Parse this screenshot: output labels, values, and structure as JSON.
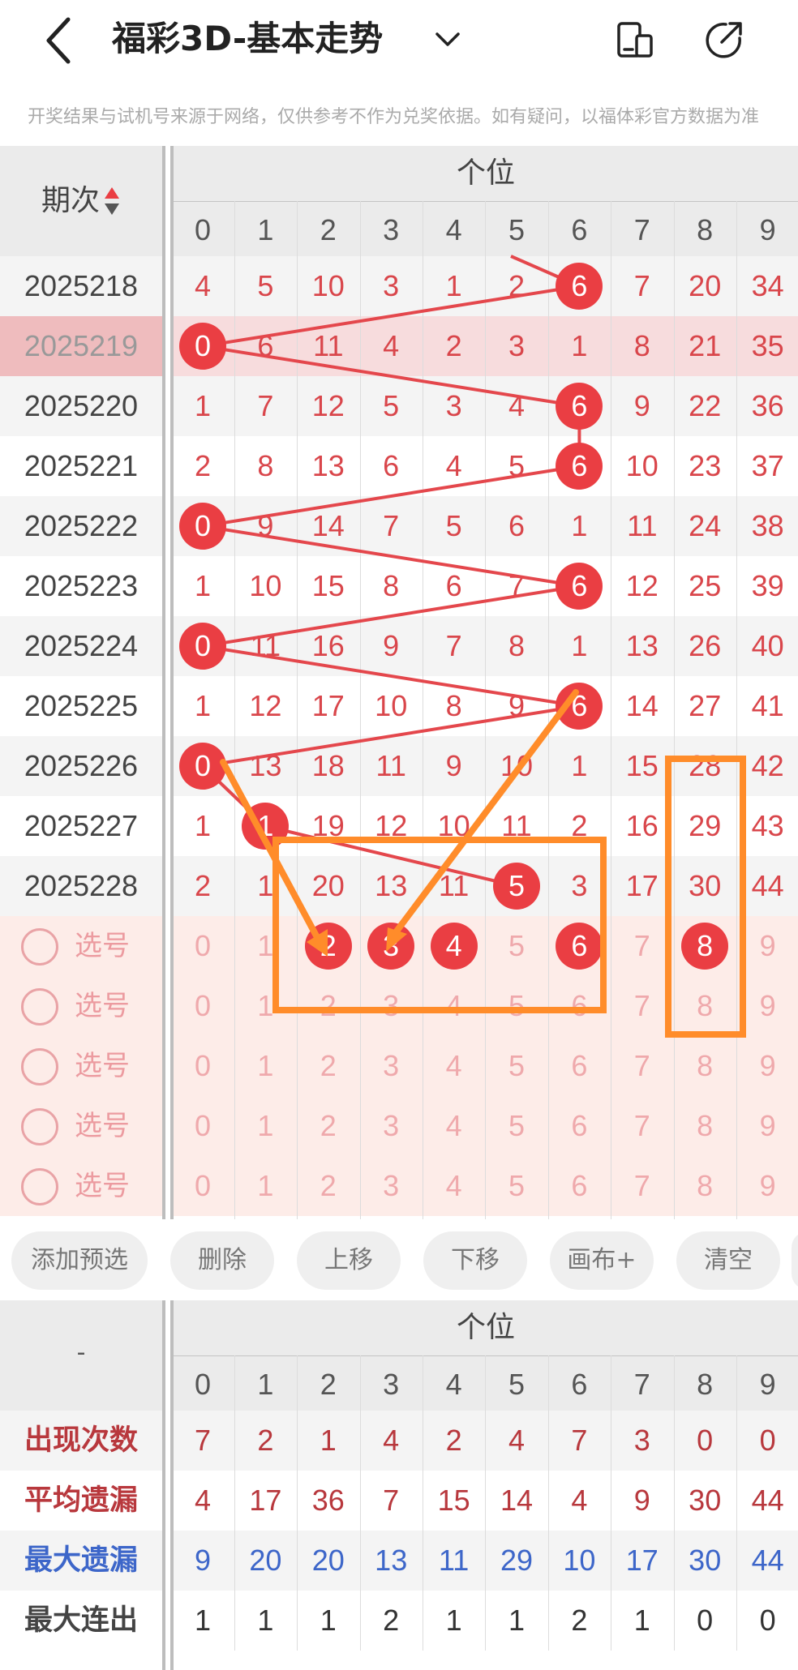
{
  "header": {
    "title": "福彩3D-基本走势",
    "notice": "开奖结果与试机号来源于网络，仅供参考不作为兑奖依据。如有疑问，以福体彩官方数据为准"
  },
  "table": {
    "period_header": "期次",
    "group_header": "个位",
    "digits": [
      "0",
      "1",
      "2",
      "3",
      "4",
      "5",
      "6",
      "7",
      "8",
      "9"
    ],
    "rows": [
      {
        "period": "2025218",
        "values": [
          "4",
          "5",
          "10",
          "3",
          "1",
          "2",
          "6",
          "7",
          "20",
          "34"
        ],
        "hit": 6
      },
      {
        "period": "2025219",
        "values": [
          "0",
          "6",
          "11",
          "4",
          "2",
          "3",
          "1",
          "8",
          "21",
          "35"
        ],
        "hit": 0
      },
      {
        "period": "2025220",
        "values": [
          "1",
          "7",
          "12",
          "5",
          "3",
          "4",
          "6",
          "9",
          "22",
          "36"
        ],
        "hit": 6
      },
      {
        "period": "2025221",
        "values": [
          "2",
          "8",
          "13",
          "6",
          "4",
          "5",
          "6",
          "10",
          "23",
          "37"
        ],
        "hit": 6
      },
      {
        "period": "2025222",
        "values": [
          "0",
          "9",
          "14",
          "7",
          "5",
          "6",
          "1",
          "11",
          "24",
          "38"
        ],
        "hit": 0
      },
      {
        "period": "2025223",
        "values": [
          "1",
          "10",
          "15",
          "8",
          "6",
          "7",
          "6",
          "12",
          "25",
          "39"
        ],
        "hit": 6
      },
      {
        "period": "2025224",
        "values": [
          "0",
          "11",
          "16",
          "9",
          "7",
          "8",
          "1",
          "13",
          "26",
          "40"
        ],
        "hit": 0
      },
      {
        "period": "2025225",
        "values": [
          "1",
          "12",
          "17",
          "10",
          "8",
          "9",
          "6",
          "14",
          "27",
          "41"
        ],
        "hit": 6
      },
      {
        "period": "2025226",
        "values": [
          "0",
          "13",
          "18",
          "11",
          "9",
          "10",
          "1",
          "15",
          "28",
          "42"
        ],
        "hit": 0
      },
      {
        "period": "2025227",
        "values": [
          "1",
          "1",
          "19",
          "12",
          "10",
          "11",
          "2",
          "16",
          "29",
          "43"
        ],
        "hit": 1
      },
      {
        "period": "2025228",
        "values": [
          "2",
          "1",
          "20",
          "13",
          "11",
          "5",
          "3",
          "17",
          "30",
          "44"
        ],
        "hit": 5
      }
    ],
    "pick_label": "选号",
    "pick_rows": 5,
    "selected_first_row": [
      2,
      3,
      4,
      6,
      8
    ]
  },
  "toolbar": {
    "buttons": [
      "添加预选",
      "删除",
      "上移",
      "下移",
      "画布+",
      "清空"
    ]
  },
  "stats": {
    "corner": "-",
    "group_header": "个位",
    "rows": [
      {
        "label": "出现次数",
        "values": [
          "7",
          "2",
          "1",
          "4",
          "2",
          "4",
          "7",
          "3",
          "0",
          "0"
        ]
      },
      {
        "label": "平均遗漏",
        "values": [
          "4",
          "17",
          "36",
          "7",
          "15",
          "14",
          "4",
          "9",
          "30",
          "44"
        ]
      },
      {
        "label": "最大遗漏",
        "values": [
          "9",
          "20",
          "20",
          "13",
          "11",
          "29",
          "10",
          "17",
          "30",
          "44"
        ]
      },
      {
        "label": "最大连出",
        "values": [
          "1",
          "1",
          "1",
          "2",
          "1",
          "1",
          "2",
          "1",
          "0",
          "0"
        ]
      }
    ]
  },
  "colors": {
    "accent_red": "#ea3e43",
    "miss_red": "#d9464b",
    "stat_red": "#b8383d",
    "stat_blue": "#3d66c9",
    "annotation_orange": "#ff8c2a",
    "pick_bg": "#fdece8"
  }
}
